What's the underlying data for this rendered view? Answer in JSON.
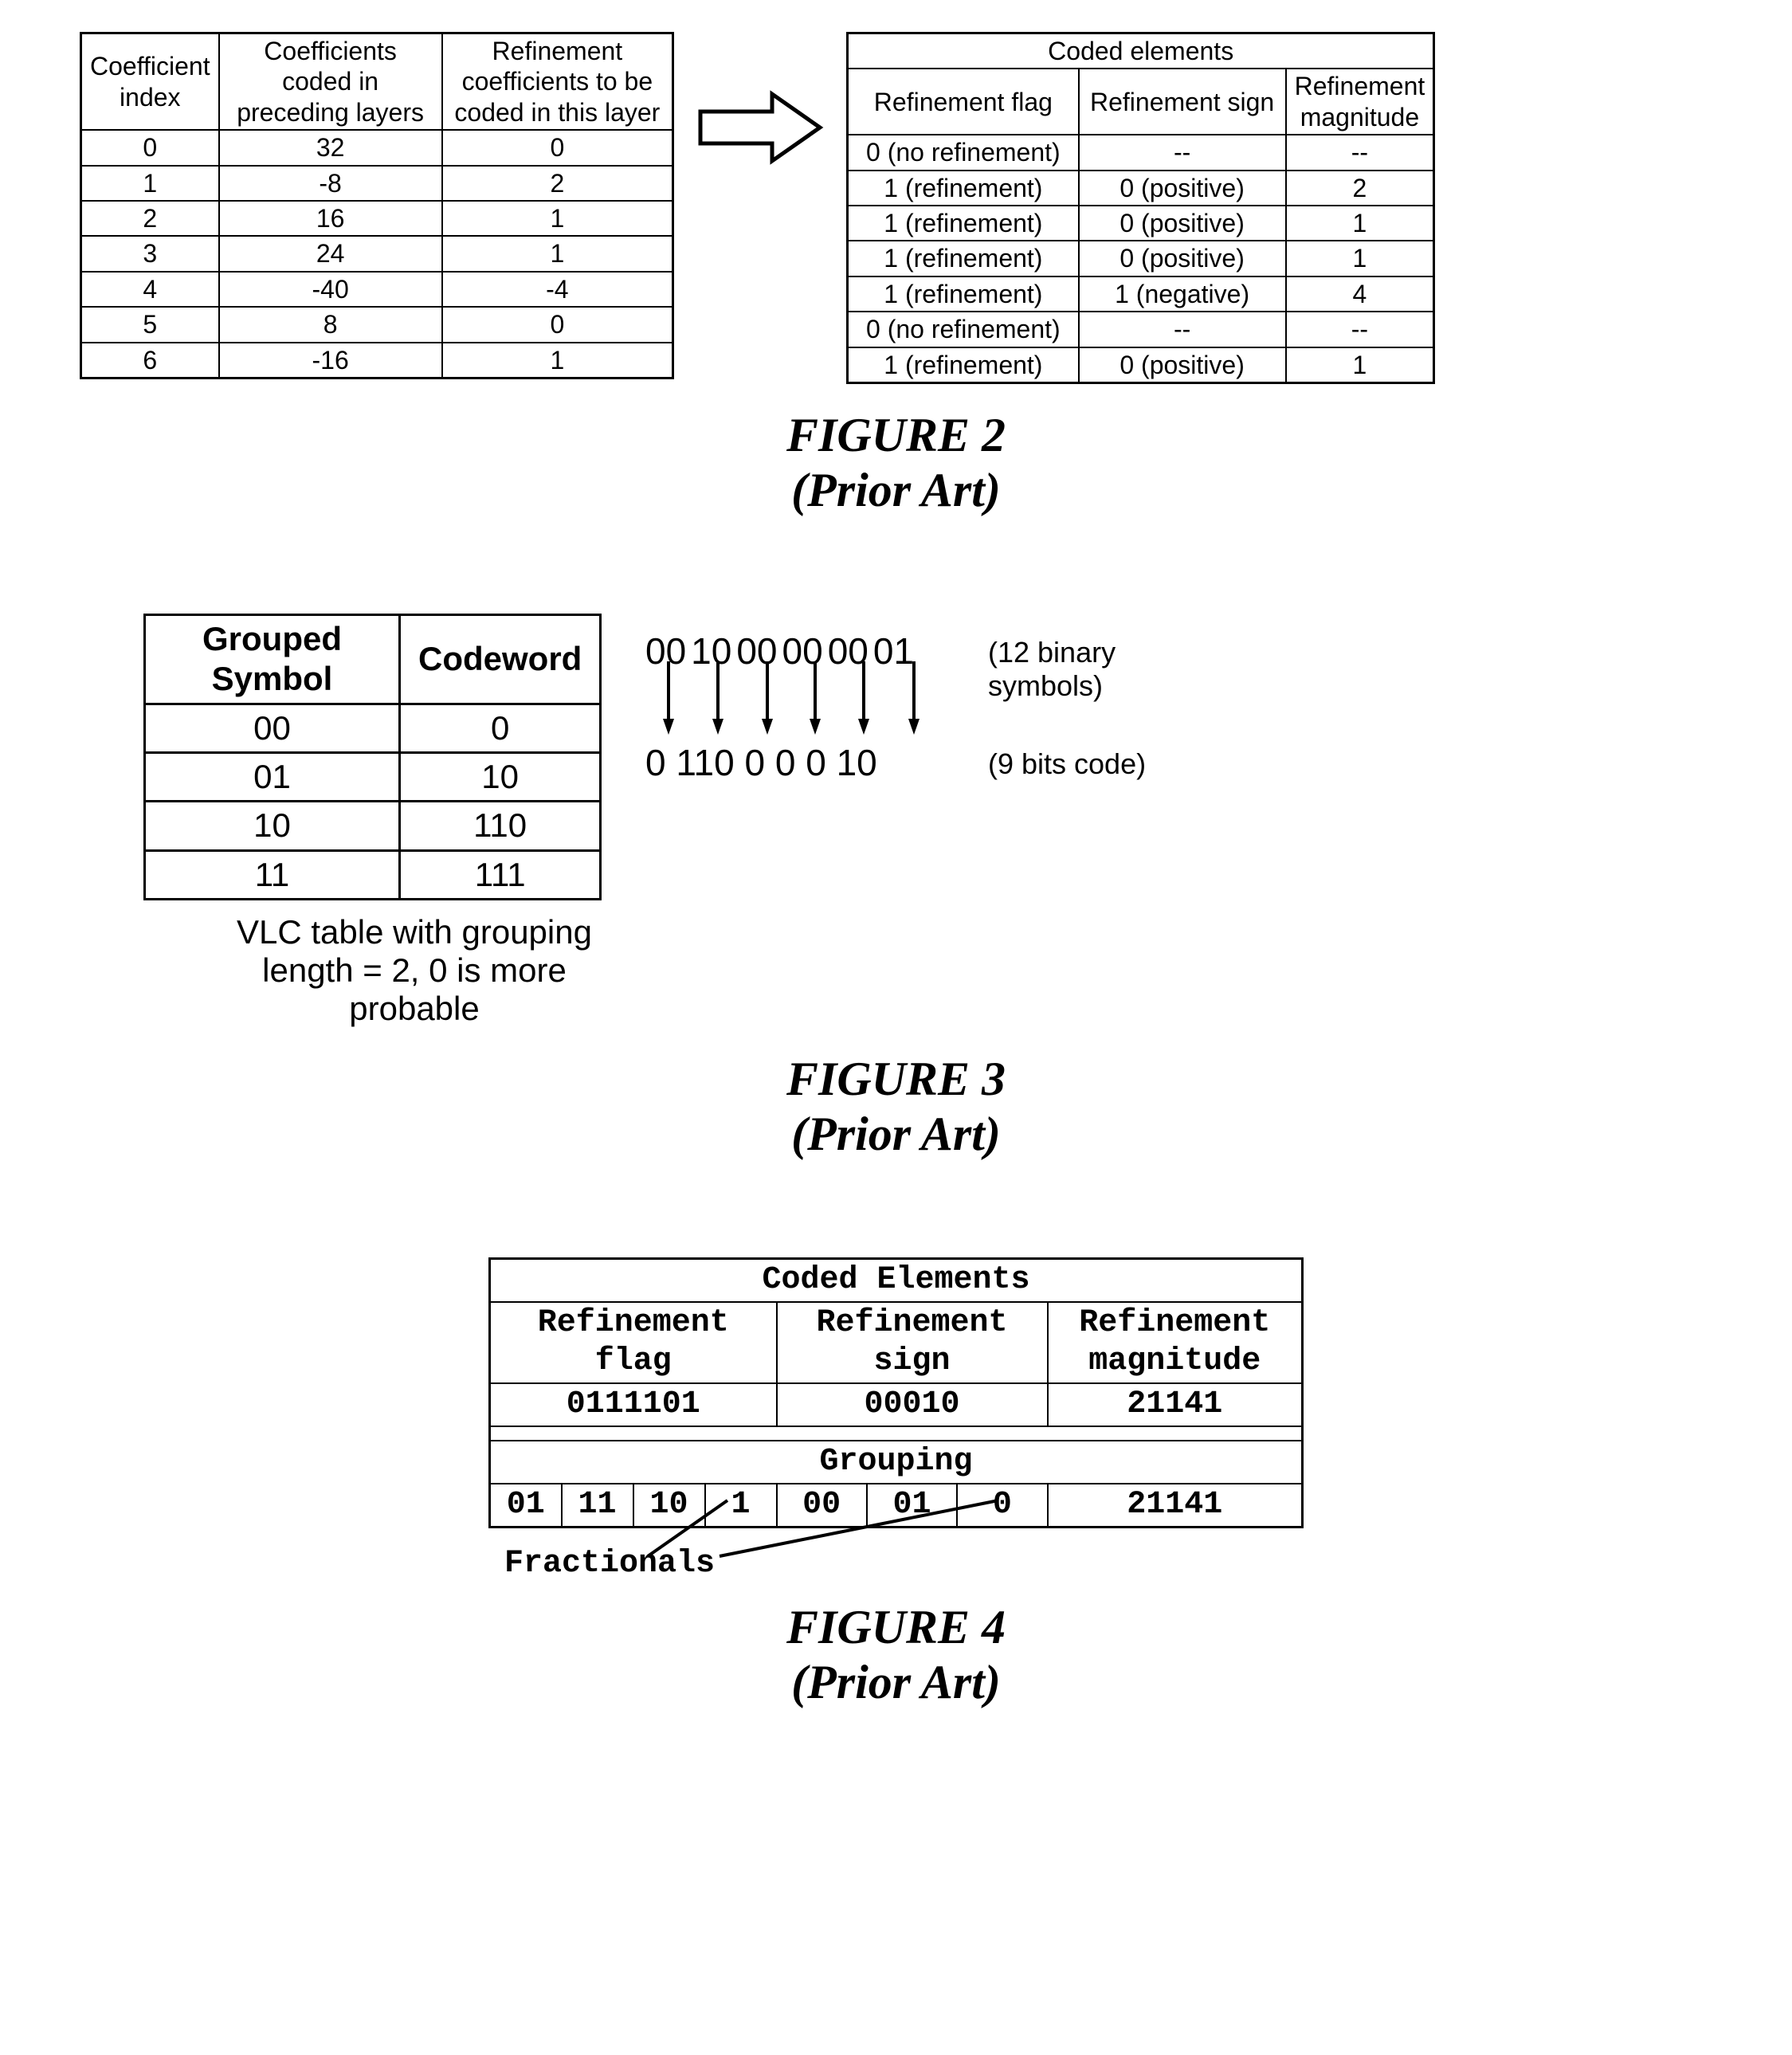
{
  "fig2": {
    "left": {
      "headers": [
        "Coefficient index",
        "Coefficients coded in preceding layers",
        "Refinement coefficients to be coded in this layer"
      ],
      "rows": [
        [
          "0",
          "32",
          "0"
        ],
        [
          "1",
          "-8",
          "2"
        ],
        [
          "2",
          "16",
          "1"
        ],
        [
          "3",
          "24",
          "1"
        ],
        [
          "4",
          "-40",
          "-4"
        ],
        [
          "5",
          "8",
          "0"
        ],
        [
          "6",
          "-16",
          "1"
        ]
      ]
    },
    "right": {
      "title": "Coded elements",
      "headers": [
        "Refinement flag",
        "Refinement sign",
        "Refinement magnitude"
      ],
      "rows": [
        [
          "0 (no refinement)",
          "--",
          "--"
        ],
        [
          "1 (refinement)",
          "0 (positive)",
          "2"
        ],
        [
          "1 (refinement)",
          "0 (positive)",
          "1"
        ],
        [
          "1 (refinement)",
          "0 (positive)",
          "1"
        ],
        [
          "1 (refinement)",
          "1 (negative)",
          "4"
        ],
        [
          "0 (no refinement)",
          "--",
          "--"
        ],
        [
          "1 (refinement)",
          "0 (positive)",
          "1"
        ]
      ]
    },
    "caption": "FIGURE 2",
    "sub": "(Prior Art)"
  },
  "fig3": {
    "table": {
      "headers": [
        "Grouped Symbol",
        "Codeword"
      ],
      "rows": [
        [
          "00",
          "0"
        ],
        [
          "01",
          "10"
        ],
        [
          "10",
          "110"
        ],
        [
          "11",
          "111"
        ]
      ]
    },
    "table_caption": "VLC table with grouping length = 2, 0 is more probable",
    "symbols_top_groups": [
      "00",
      "10",
      "00",
      "00",
      "00",
      "01"
    ],
    "note_top": "(12 binary symbols)",
    "symbols_bottom": "0 110 0 0  0 10",
    "note_bottom": "(9 bits code)",
    "caption": "FIGURE 3",
    "sub": "(Prior Art)"
  },
  "fig4": {
    "title": "Coded Elements",
    "headers": [
      "Refinement flag",
      "Refinement sign",
      "Refinement magnitude"
    ],
    "row1": [
      "0111101",
      "00010",
      "21141"
    ],
    "grouping_title": "Grouping",
    "row2": [
      "01",
      "11",
      "10",
      "1",
      "00",
      "01",
      "0",
      "21141"
    ],
    "fractionals_label": "Fractionals",
    "caption": "FIGURE 4",
    "sub": "(Prior Art)"
  }
}
